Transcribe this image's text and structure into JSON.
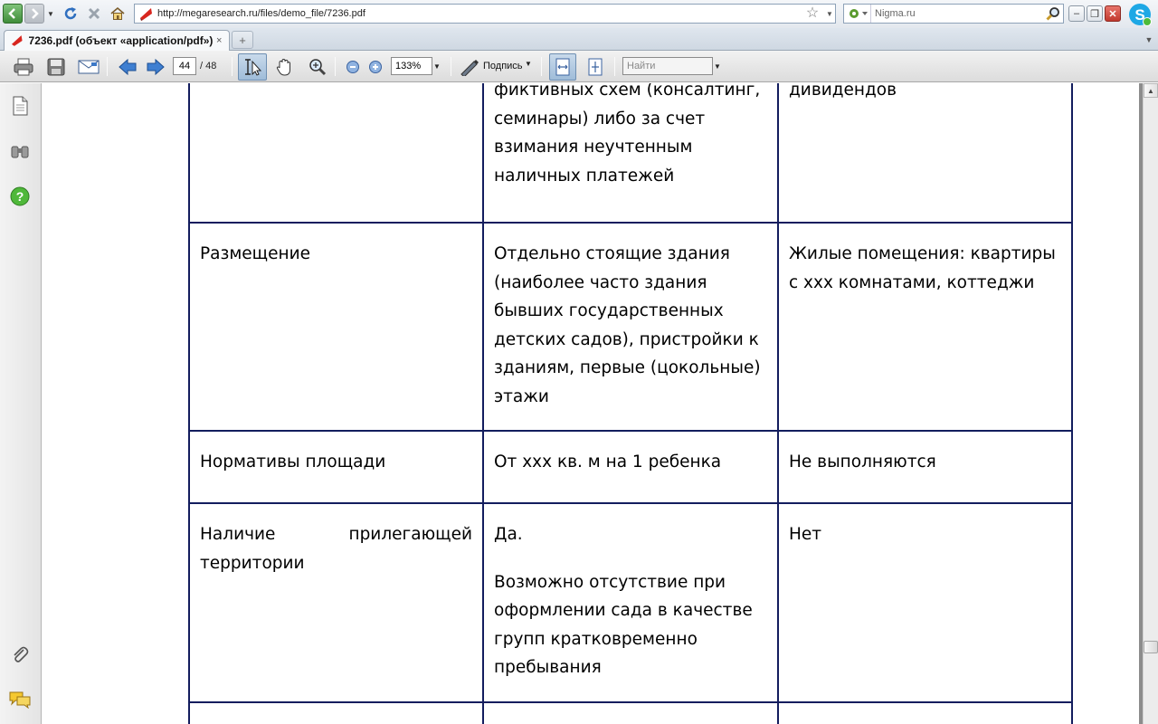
{
  "browser": {
    "url": "http://megaresearch.ru/files/demo_file/7236.pdf",
    "search_placeholder": "Nigma.ru",
    "tab_title": "7236.pdf (объект «application/pdf»)",
    "tab_new_label": "+",
    "tab_close_label": "×"
  },
  "pdf_toolbar": {
    "current_page": "44",
    "total_pages": "/ 48",
    "zoom": "133%",
    "sign_label": "Подпись",
    "find_placeholder": "Найти"
  },
  "document": {
    "rows": [
      {
        "col1": [],
        "col2": [
          "фиктивных схем (консалтинг, семинары) либо за счет взимания неучтенным наличных платежей"
        ],
        "col3": [
          "дивидендов"
        ]
      },
      {
        "col1": [
          "Размещение"
        ],
        "col2": [
          "Отдельно стоящие здания (наиболее часто здания бывших государственных детских садов), пристройки к зданиям, первые (цокольные) этажи"
        ],
        "col3": [
          "Жилые помещения: квартиры с ххх комнатами, коттеджи"
        ]
      },
      {
        "col1": [
          "Нормативы площади"
        ],
        "col2": [
          "От ххх кв. м на 1 ребенка"
        ],
        "col3": [
          "Не выполняются"
        ]
      },
      {
        "col1": [
          "Наличие прилегающей",
          "территории"
        ],
        "col2": [
          "Да.",
          "Возможно отсутствие при оформлении сада в качестве групп кратковременно пребывания"
        ],
        "col3": [
          "Нет"
        ]
      }
    ]
  },
  "colors": {
    "table_border": "#131d5e",
    "viewer_background": "#8c8c8c"
  },
  "icons": {
    "nav": [
      "back-icon",
      "forward-icon",
      "reload-icon",
      "stop-icon",
      "home-icon"
    ],
    "pdf_toolbar": [
      "print-icon",
      "save-icon",
      "email-icon",
      "previous-page-icon",
      "next-page-icon",
      "select-text-icon",
      "hand-tool-icon",
      "zoom-tool-icon",
      "zoom-out-icon",
      "zoom-in-icon",
      "sign-icon",
      "fit-width-icon",
      "fit-page-icon"
    ],
    "left_pane": [
      "pages-icon",
      "binoculars-icon",
      "help-icon",
      "attachment-icon",
      "comments-icon"
    ]
  }
}
